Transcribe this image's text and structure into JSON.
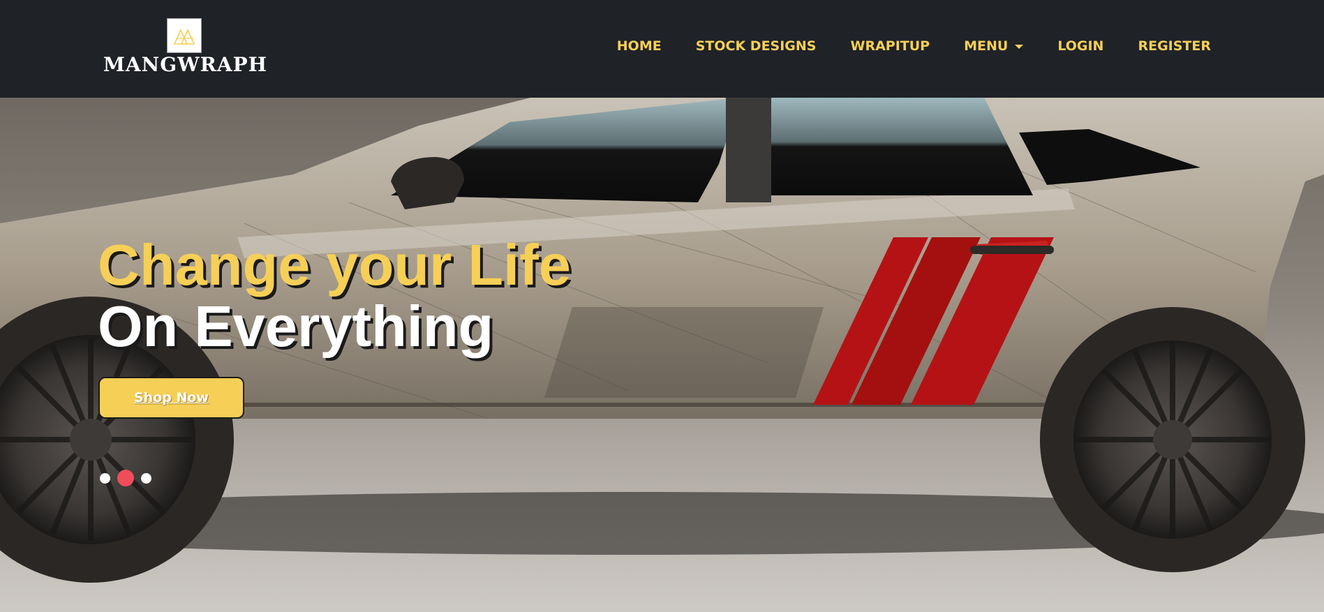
{
  "brand": {
    "name": "MANGWRAPH",
    "logo_icon": "triangle-mountain-icon"
  },
  "nav": {
    "items": [
      {
        "label": "HOME"
      },
      {
        "label": "STOCK DESIGNS"
      },
      {
        "label": "WRAPITUP"
      },
      {
        "label": "MENU",
        "icon": "caret-down-icon"
      },
      {
        "label": "LOGIN"
      },
      {
        "label": "REGISTER"
      }
    ]
  },
  "hero": {
    "headline_line1": "Change your Life",
    "headline_line2": "On Everything",
    "cta_label": "Shop Now",
    "carousel": {
      "slides": 3,
      "active_index": 1
    }
  },
  "colors": {
    "navbar_bg": "#1f2227",
    "accent_yellow": "#f6cf57",
    "headline_white": "#ffffff",
    "active_dot": "#f04c5a",
    "car_stripe_red": "#b51216"
  }
}
